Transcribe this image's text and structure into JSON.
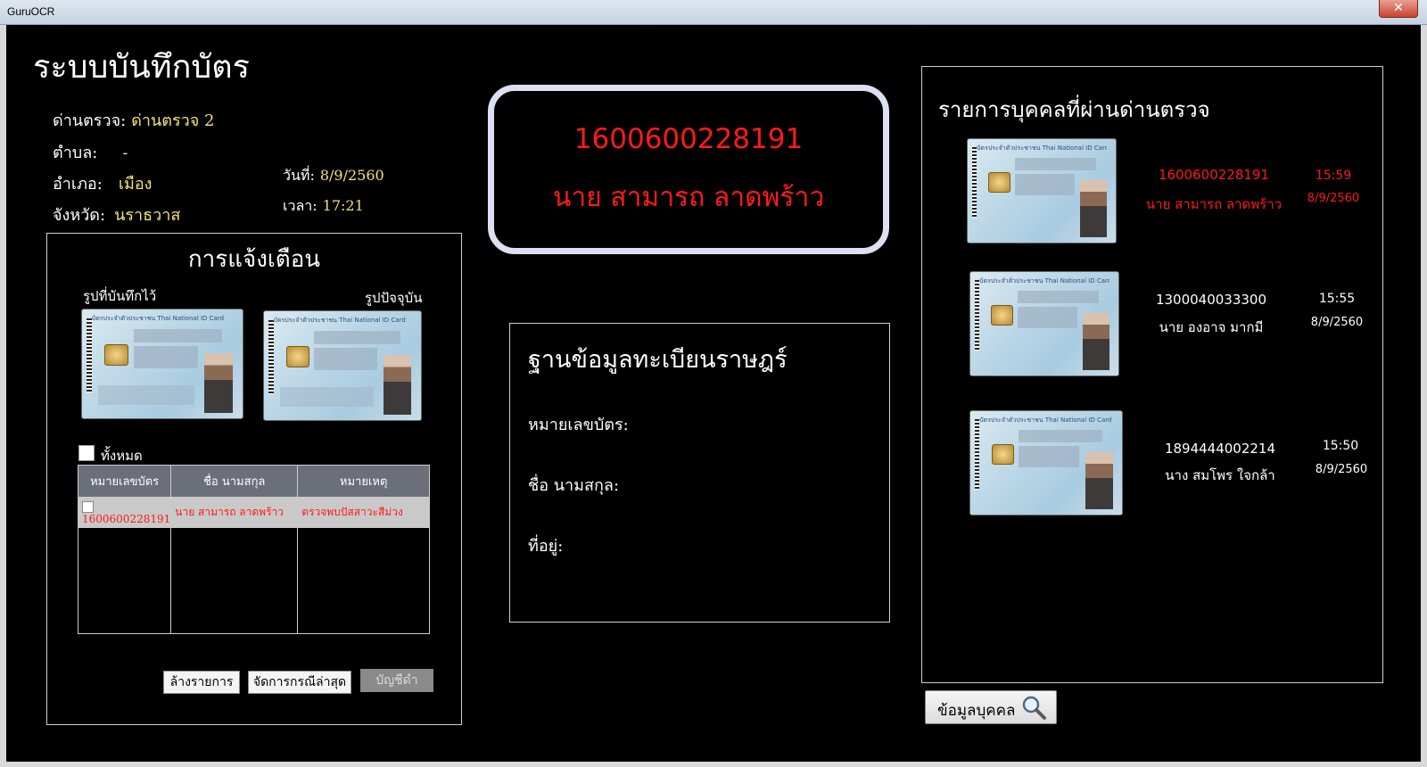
{
  "window": {
    "title": "GuruOCR",
    "close_glyph": "✕"
  },
  "app_title": "ระบบบันทึกบัตร",
  "checkpoint": {
    "checkpoint_label": "ด่านตรวจ:",
    "checkpoint_value": "ด่านตรวจ 2",
    "subdistrict_label": "ตำบล:",
    "subdistrict_value": "-",
    "district_label": "อำเภอ:",
    "district_value": "เมือง",
    "province_label": "จังหวัด:",
    "province_value": "นราธวาส",
    "date_label": "วันที่:",
    "date_value": "8/9/2560",
    "time_label": "เวลา:",
    "time_value": "17:21"
  },
  "alert_panel": {
    "title": "การแจ้งเตือน",
    "saved_image_caption": "รูปที่บันทึกไว้",
    "current_image_caption": "รูปปัจจุบัน",
    "select_all_label": "ทั้งหมด",
    "table": {
      "headers": [
        "หมายเลขบัตร",
        "ชื่อ นามสกุล",
        "หมายเหตุ"
      ],
      "rows": [
        {
          "id": "1600600228191",
          "name": "นาย สามารถ ลาดพร้าว",
          "note": "ตรวจพบปัสสาวะสีม่วง"
        }
      ]
    },
    "buttons": {
      "clear": "ล้างรายการ",
      "handle_latest": "จัดการกรณีล่าสุด",
      "blacklist": "บัญชีดำ"
    }
  },
  "id_card_header_text": "บัตรประจำตัวประชาชน Thai National ID Card",
  "current_scan": {
    "id": "1600600228191",
    "name": "นาย สามารถ ลาดพร้าว"
  },
  "registry": {
    "title": "ฐานข้อมูลทะเบียนราษฎร์",
    "id_label": "หมายเลขบัตร:",
    "name_label": "ชื่อ นามสกุล:",
    "address_label": "ที่อยู่:"
  },
  "persons_panel": {
    "title": "รายการบุคคลที่ผ่านด่านตรวจ",
    "entries": [
      {
        "id": "1600600228191",
        "name": "นาย สามารถ ลาดพร้าว",
        "time": "15:59",
        "date": "8/9/2560"
      },
      {
        "id": "1300040033300",
        "name": "นาย องอาจ มากมี",
        "time": "15:55",
        "date": "8/9/2560"
      },
      {
        "id": "1894444002214",
        "name": "นาง สมโพร ใจกล้า",
        "time": "15:50",
        "date": "8/9/2560"
      }
    ]
  },
  "person_info_button": "ข้อมูลบุคคล",
  "colors": {
    "highlight": "#ff1a1a",
    "value_yellow": "#f3e37a",
    "background": "#000000"
  }
}
